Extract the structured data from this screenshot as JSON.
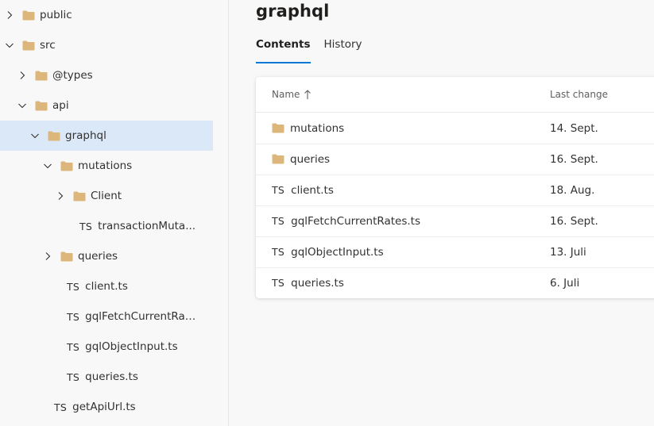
{
  "sidebar": {
    "items": [
      {
        "label": "public",
        "type": "folder",
        "expanded": false,
        "depth": 0
      },
      {
        "label": "src",
        "type": "folder",
        "expanded": true,
        "depth": 0
      },
      {
        "label": "@types",
        "type": "folder",
        "expanded": false,
        "depth": 1
      },
      {
        "label": "api",
        "type": "folder",
        "expanded": true,
        "depth": 1
      },
      {
        "label": "graphql",
        "type": "folder",
        "expanded": true,
        "depth": 2,
        "selected": true
      },
      {
        "label": "mutations",
        "type": "folder",
        "expanded": true,
        "depth": 3
      },
      {
        "label": "Client",
        "type": "folder",
        "expanded": false,
        "depth": 4
      },
      {
        "label": "transactionMuta...",
        "type": "ts",
        "depth": 4
      },
      {
        "label": "queries",
        "type": "folder",
        "expanded": false,
        "depth": 3
      },
      {
        "label": "client.ts",
        "type": "ts",
        "depth": 3
      },
      {
        "label": "gqlFetchCurrentRat...",
        "type": "ts",
        "depth": 3
      },
      {
        "label": "gqlObjectInput.ts",
        "type": "ts",
        "depth": 3
      },
      {
        "label": "queries.ts",
        "type": "ts",
        "depth": 3
      },
      {
        "label": "getApiUrl.ts",
        "type": "ts",
        "depth": 2
      }
    ]
  },
  "main": {
    "title": "graphql",
    "tabs": [
      {
        "label": "Contents",
        "active": true
      },
      {
        "label": "History",
        "active": false
      }
    ],
    "table": {
      "columns": {
        "name": "Name",
        "last_change": "Last change"
      },
      "rows": [
        {
          "name": "mutations",
          "type": "folder",
          "last_change": "14. Sept."
        },
        {
          "name": "queries",
          "type": "folder",
          "last_change": "16. Sept."
        },
        {
          "name": "client.ts",
          "type": "ts",
          "last_change": "18. Aug."
        },
        {
          "name": "gqlFetchCurrentRates.ts",
          "type": "ts",
          "last_change": "16. Sept."
        },
        {
          "name": "gqlObjectInput.ts",
          "type": "ts",
          "last_change": "13. Juli"
        },
        {
          "name": "queries.ts",
          "type": "ts",
          "last_change": "6. Juli"
        }
      ]
    }
  },
  "icons": {
    "folder": "folder-icon",
    "ts_file": "ts-icon",
    "ts_label": "TS",
    "chevron_right": "chevron-right-icon",
    "chevron_down": "chevron-down-icon",
    "sort": "sort-ascending-icon"
  },
  "colors": {
    "folder": "#dcb67a",
    "selected_row": "#dbe8f7",
    "accent": "#0078d4"
  }
}
